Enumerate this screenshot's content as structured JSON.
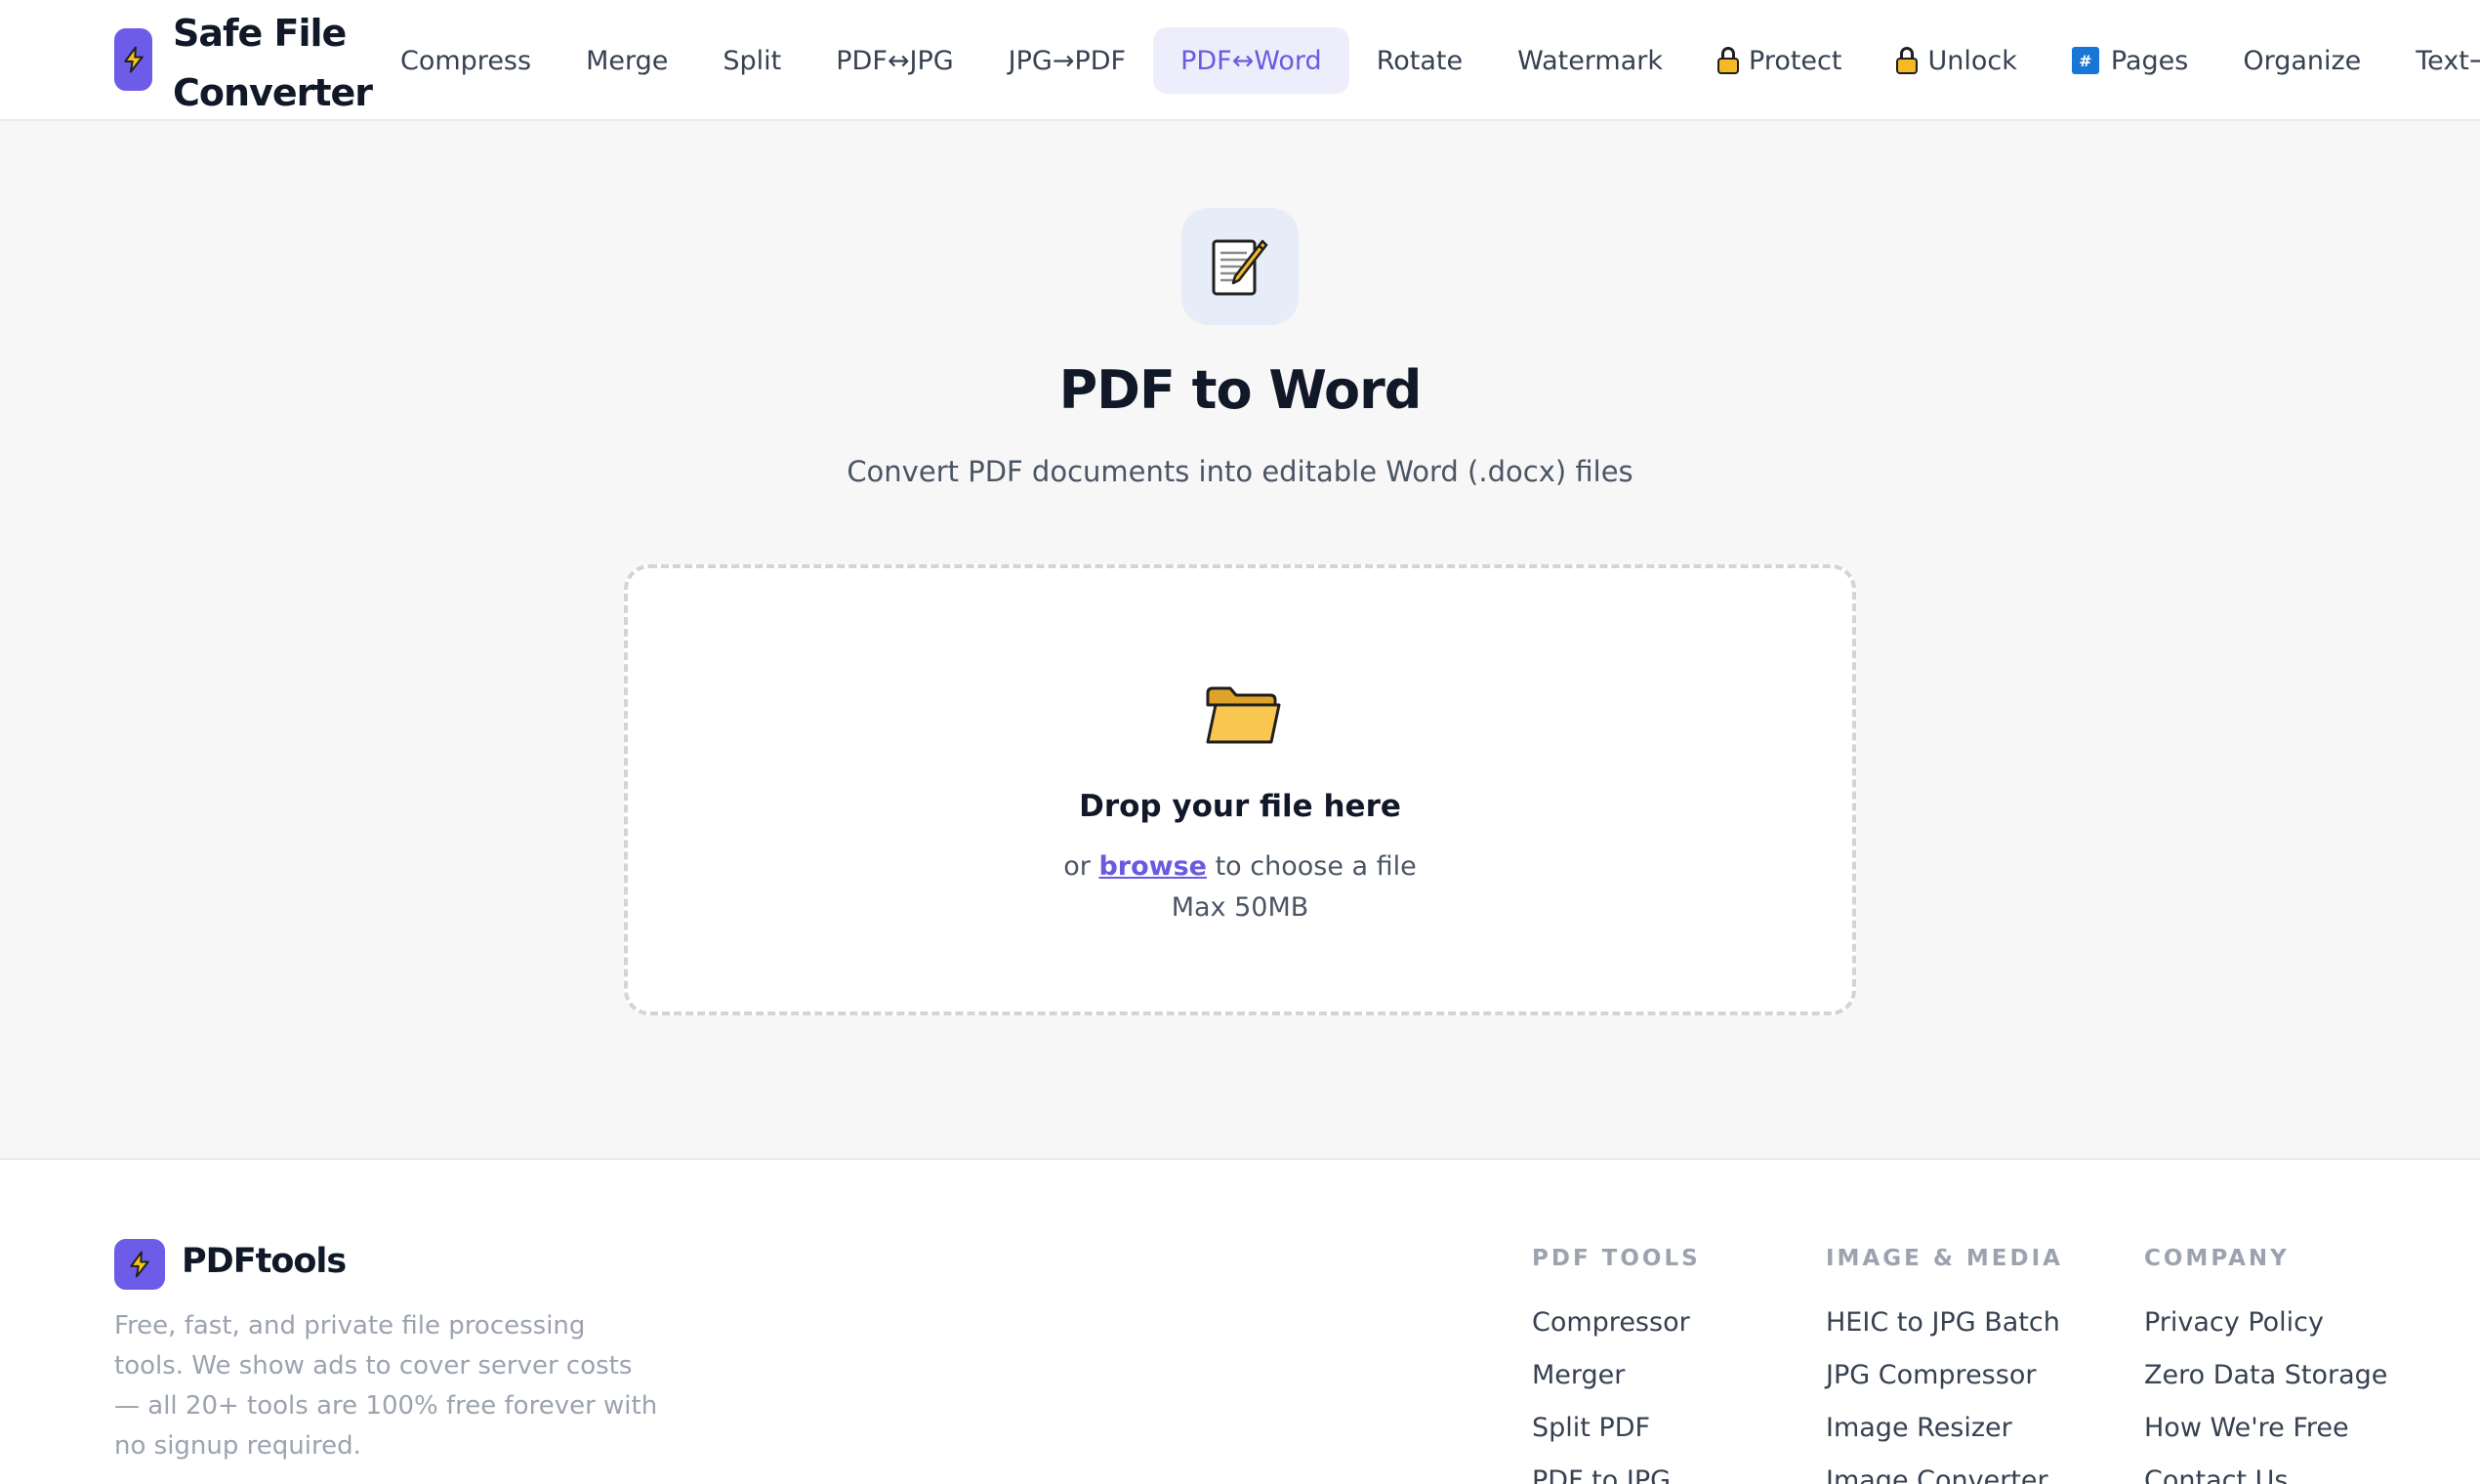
{
  "brand": {
    "name": "Safe File Converter"
  },
  "nav": {
    "items": [
      {
        "label": "Compress",
        "icon": ""
      },
      {
        "label": "Merge",
        "icon": ""
      },
      {
        "label": "Split",
        "icon": ""
      },
      {
        "label": "PDF↔JPG",
        "icon": ""
      },
      {
        "label": "JPG→PDF",
        "icon": ""
      },
      {
        "label": "PDF↔Word",
        "icon": "",
        "active": true
      },
      {
        "label": "Rotate",
        "icon": ""
      },
      {
        "label": "Watermark",
        "icon": ""
      },
      {
        "label": "Protect",
        "icon": "lock-icon"
      },
      {
        "label": "Unlock",
        "icon": "lock-icon"
      },
      {
        "label": "Pages",
        "icon": "hash-icon"
      },
      {
        "label": "Organize",
        "icon": ""
      },
      {
        "label": "Text→PDF",
        "icon": ""
      }
    ]
  },
  "tool": {
    "icon": "memo-icon",
    "title": "PDF to Word",
    "subtitle": "Convert PDF documents into editable Word (.docx) files"
  },
  "dropzone": {
    "icon": "folder-icon",
    "title": "Drop your file here",
    "prefix": "or",
    "browse": "browse",
    "suffix": "to choose a file",
    "max": "Max 50MB"
  },
  "footer": {
    "brand": "PDFtools",
    "description": "Free, fast, and private file processing tools. We show ads to cover server costs — all 20+ tools are 100% free forever with no signup required.",
    "columns": [
      {
        "title": "PDF TOOLS",
        "links": [
          "Compressor",
          "Merger",
          "Split PDF",
          "PDF to JPG"
        ]
      },
      {
        "title": "IMAGE & MEDIA",
        "links": [
          "HEIC to JPG Batch",
          "JPG Compressor",
          "Image Resizer",
          "Image Converter"
        ]
      },
      {
        "title": "COMPANY",
        "links": [
          "Privacy Policy",
          "Zero Data Storage",
          "How We're Free",
          "Contact Us"
        ]
      }
    ]
  },
  "colors": {
    "accent": "#6d5ce8",
    "accent_text": "#6a5ae0",
    "active_nav_bg": "#eeedfb",
    "page_bg": "#f7f7f8"
  }
}
